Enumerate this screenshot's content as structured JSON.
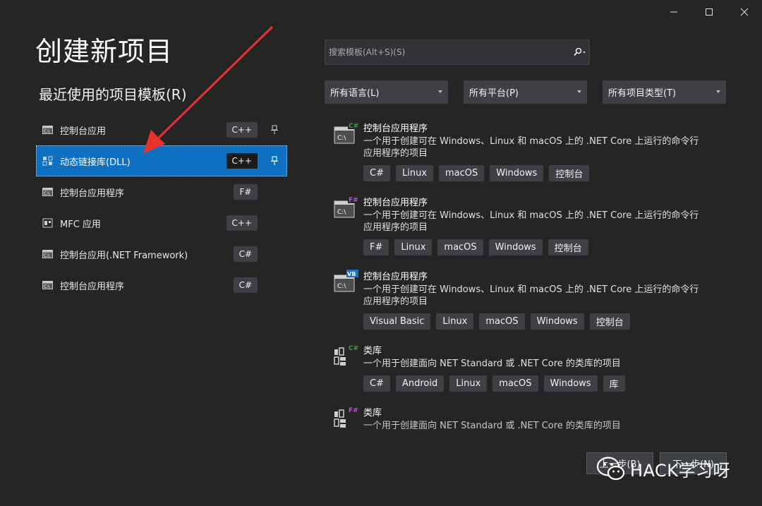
{
  "window": {
    "minimize_icon": "minimize-icon",
    "maximize_icon": "maximize-icon",
    "close_icon": "close-icon"
  },
  "page_title": "创建新项目",
  "recent": {
    "title": "最近使用的项目模板(R)",
    "items": [
      {
        "label": "控制台应用",
        "lang": "C++",
        "pinned": true,
        "selected": false,
        "icon": "console-app-icon"
      },
      {
        "label": "动态链接库(DLL)",
        "lang": "C++",
        "pinned": true,
        "selected": true,
        "icon": "dll-icon"
      },
      {
        "label": "控制台应用程序",
        "lang": "F#",
        "pinned": false,
        "selected": false,
        "icon": "console-app-icon"
      },
      {
        "label": "MFC 应用",
        "lang": "C++",
        "pinned": false,
        "selected": false,
        "icon": "mfc-app-icon"
      },
      {
        "label": "控制台应用(.NET Framework)",
        "lang": "C#",
        "pinned": false,
        "selected": false,
        "icon": "console-app-icon"
      },
      {
        "label": "控制台应用程序",
        "lang": "C#",
        "pinned": false,
        "selected": false,
        "icon": "console-app-icon"
      }
    ]
  },
  "search": {
    "placeholder": "搜索模板(Alt+S)(S)"
  },
  "filters": {
    "language": "所有语言(L)",
    "platform": "所有平台(P)",
    "project_type": "所有项目类型(T)"
  },
  "templates": [
    {
      "title": "控制台应用程序",
      "badge": "C#",
      "badge_color": "#388a34",
      "desc": "一个用于创建可在 Windows、Linux 和 macOS 上的 .NET Core 上运行的命令行应用程序的项目",
      "tags": [
        "C#",
        "Linux",
        "macOS",
        "Windows",
        "控制台"
      ]
    },
    {
      "title": "控制台应用程序",
      "badge": "F#",
      "badge_color": "#a64bc3",
      "desc": "一个用于创建可在 Windows、Linux 和 macOS 上的 .NET Core 上运行的命令行应用程序的项目",
      "tags": [
        "F#",
        "Linux",
        "macOS",
        "Windows",
        "控制台"
      ]
    },
    {
      "title": "控制台应用程序",
      "badge": "VB",
      "badge_color": "#1f6fc5",
      "desc": "一个用于创建可在 Windows、Linux 和 macOS 上的 .NET Core 上运行的命令行应用程序的项目",
      "tags": [
        "Visual Basic",
        "Linux",
        "macOS",
        "Windows",
        "控制台"
      ]
    },
    {
      "title": "类库",
      "badge": "C#",
      "badge_color": "#388a34",
      "desc": "一个用于创建面向 NET Standard 或 .NET Core 的类库的项目",
      "tags": [
        "C#",
        "Android",
        "Linux",
        "macOS",
        "Windows",
        "库"
      ]
    },
    {
      "title": "类库",
      "badge": "F#",
      "badge_color": "#a64bc3",
      "desc": "一个用于创建面向 NET Standard 或 .NET Core 的类库的项目",
      "tags": []
    }
  ],
  "buttons": {
    "prev": "上一步(B)",
    "next": "下一步(N)"
  },
  "watermark": {
    "text": "HACK学习呀"
  },
  "colors": {
    "background": "#252526",
    "selected": "#0e70c0",
    "tag_bg": "#3f3f46",
    "arrow": "#e8322b"
  }
}
